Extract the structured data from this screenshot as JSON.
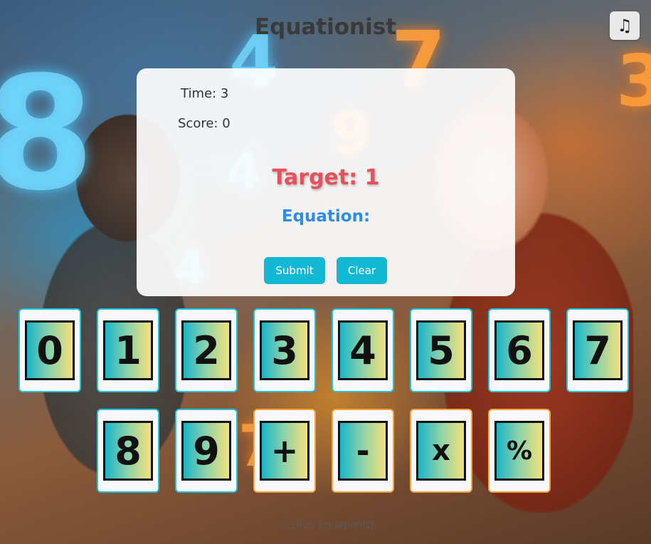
{
  "header": {
    "title": "Equationist",
    "music_icon": "music-note-icon",
    "music_glyph": "♫"
  },
  "stats": {
    "time_label": "Time: 3",
    "score_label": "Score: 0"
  },
  "game": {
    "target_label": "Target: 1",
    "equation_label": "Equation:",
    "submit_label": "Submit",
    "clear_label": "Clear"
  },
  "tiles": {
    "row1": [
      "0",
      "1",
      "2",
      "3",
      "4",
      "5",
      "6",
      "7"
    ],
    "row2_digits": [
      "8",
      "9"
    ],
    "operators": [
      "+",
      "-",
      "x",
      "%"
    ]
  },
  "colors": {
    "target": "#e8505b",
    "equation": "#2e8ce6",
    "button": "#13b8d4",
    "digit_border": "#20c4d8",
    "operator_border": "#f7a23a"
  },
  "footer": {
    "text": "© 2025 Equationist"
  }
}
